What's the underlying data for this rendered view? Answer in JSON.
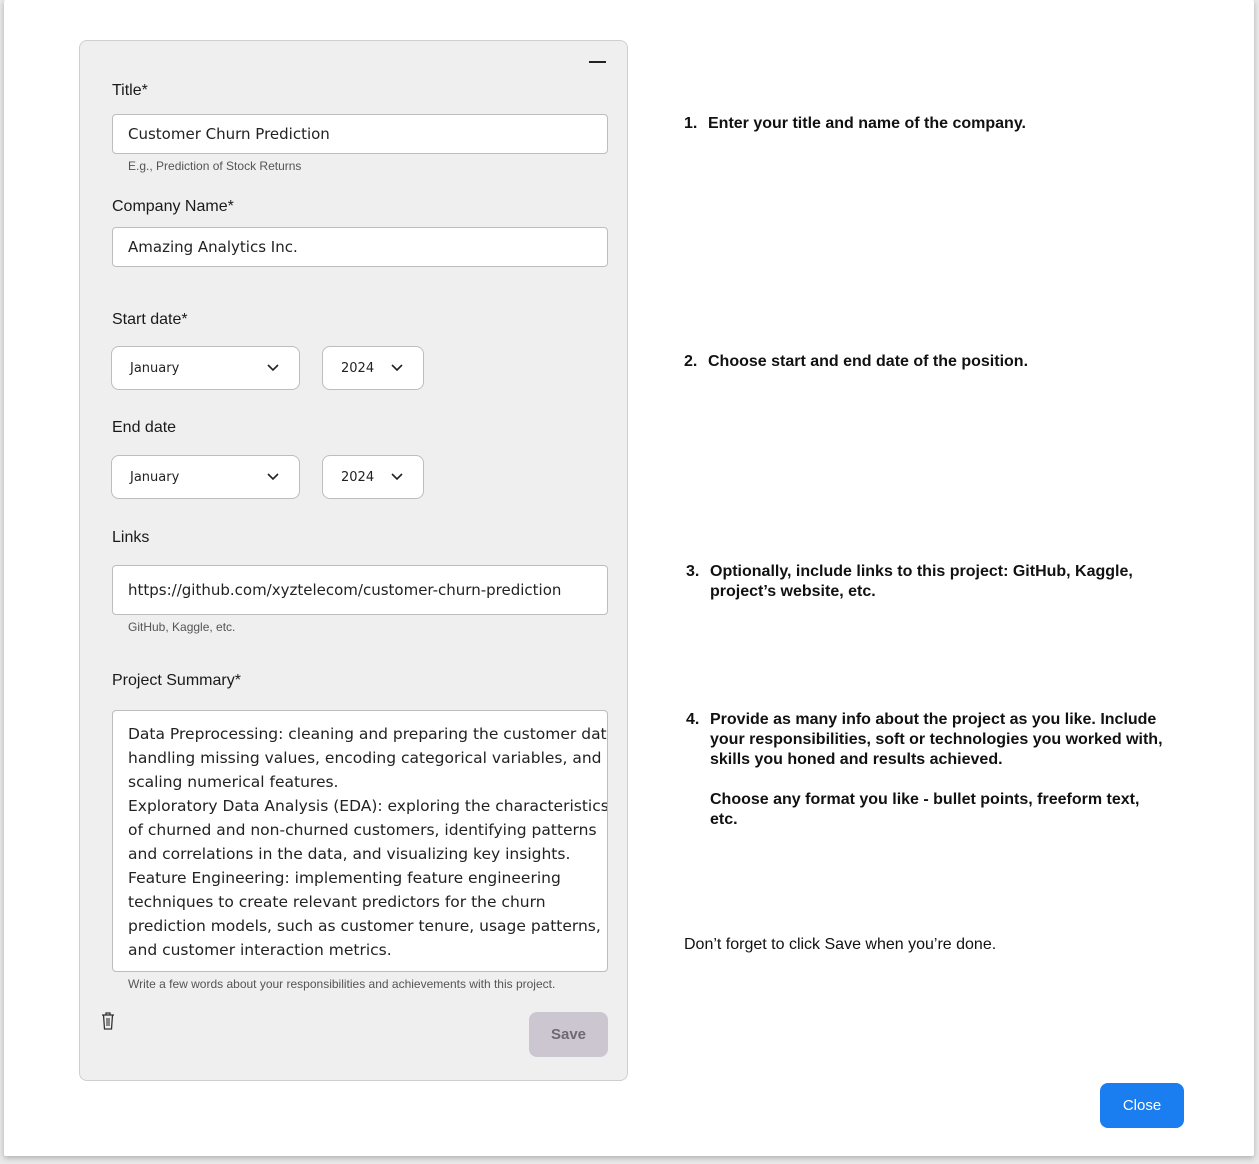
{
  "form": {
    "title_label": "Title*",
    "title_value": "Customer Churn Prediction",
    "title_helper": "E.g., Prediction of Stock Returns",
    "company_label": "Company Name*",
    "company_value": "Amazing Analytics Inc.",
    "start_label": "Start date*",
    "start_month": "January",
    "start_year": "2024",
    "end_label": "End date",
    "end_month": "January",
    "end_year": "2024",
    "links_label": "Links",
    "links_value": "https://github.com/xyztelecom/customer-churn-prediction",
    "links_helper": "GitHub, Kaggle, etc.",
    "summary_label": "Project Summary*",
    "summary_lines": [
      "Data Preprocessing: cleaning and preparing the customer data,",
      "handling missing values, encoding categorical variables, and",
      "scaling numerical features.",
      "Exploratory Data Analysis (EDA): exploring the characteristics",
      "of churned and non-churned customers, identifying patterns",
      "and correlations in the data, and visualizing key insights.",
      "Feature Engineering: implementing feature engineering",
      "techniques to create relevant predictors for the churn",
      "prediction models, such as customer tenure, usage patterns,",
      "and customer interaction metrics."
    ],
    "summary_helper": "Write a few words about your responsibilities and achievements with this project.",
    "save_label": "Save"
  },
  "instructions": [
    {
      "num": "1.",
      "lines": [
        "Enter your title and name of the company."
      ]
    },
    {
      "num": "2.",
      "lines": [
        "Choose start and end date of the position."
      ]
    },
    {
      "num": "3.",
      "lines": [
        "Optionally, include links to this project: GitHub, Kaggle,",
        "project’s website, etc."
      ]
    },
    {
      "num": "4.",
      "lines": [
        "Provide as many info about the project as you like. Include",
        "your responsibilities, soft or technologies you worked with,",
        "skills you honed and results achieved."
      ]
    }
  ],
  "instruction_4_extra": [
    "Choose any format you like - bullet points, freeform text,",
    "etc."
  ],
  "reminder": "Don’t forget to click Save when you’re done.",
  "close_label": "Close",
  "colors": {
    "primary": "#1a7ef0",
    "save_disabled": "#cbc6cf"
  },
  "icons": {
    "collapse": "minus-icon",
    "dropdown": "chevron-down-icon",
    "delete": "trash-icon"
  }
}
